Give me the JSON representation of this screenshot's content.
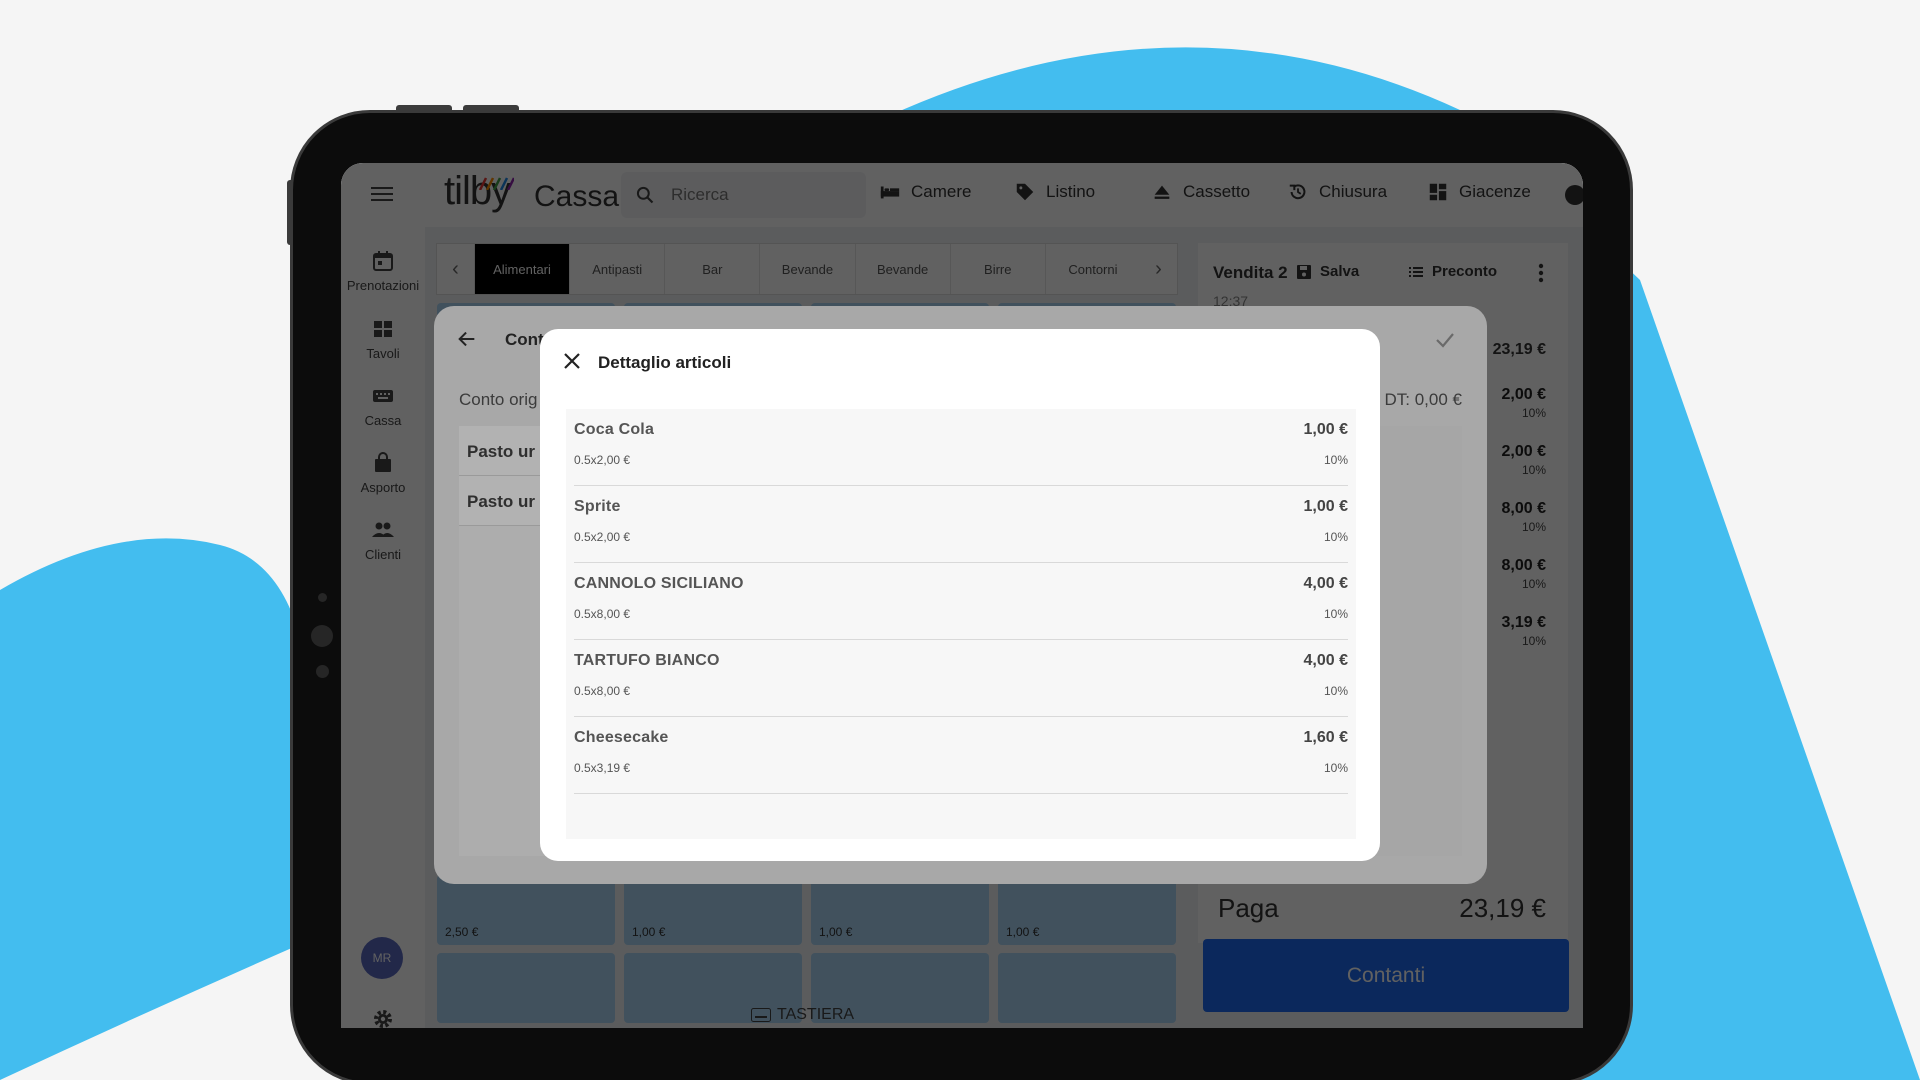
{
  "app": {
    "logo_text": "tilby",
    "title": "Cassa",
    "search_placeholder": "Ricerca"
  },
  "nav": [
    {
      "label": "Camere",
      "icon": "bed-icon"
    },
    {
      "label": "Listino",
      "icon": "price-tag-icon"
    },
    {
      "label": "Cassetto",
      "icon": "eject-icon"
    },
    {
      "label": "Chiusura",
      "icon": "history-icon"
    },
    {
      "label": "Giacenze",
      "icon": "dashboard-icon"
    }
  ],
  "rail": [
    {
      "label": "Prenotazioni",
      "icon": "calendar-icon"
    },
    {
      "label": "Tavoli",
      "icon": "tables-icon"
    },
    {
      "label": "Cassa",
      "icon": "keyboard-icon"
    },
    {
      "label": "Asporto",
      "icon": "bag-icon"
    },
    {
      "label": "Clienti",
      "icon": "people-icon"
    }
  ],
  "user_initials": "MR",
  "categories": [
    "Alimentari",
    "Antipasti",
    "Bar",
    "Bevande",
    "Bevande",
    "Birre",
    "Contorni"
  ],
  "product_prices": [
    "2,50 €",
    "1,00 €",
    "1,00 €",
    "1,00 €"
  ],
  "keyboard_label": "TASTIERA",
  "cart": {
    "title": "Vendita 2",
    "save_label": "Salva",
    "preconto_label": "Preconto",
    "time": "12:37",
    "total_label": "T: 23,19 €",
    "items": [
      {
        "value": "2,00 €",
        "vat": "10%"
      },
      {
        "value": "2,00 €",
        "vat": "10%"
      },
      {
        "value": "8,00 €",
        "vat": "10%"
      },
      {
        "value": "8,00 €",
        "vat": "10%"
      },
      {
        "value": "3,19 €",
        "vat": "10%"
      }
    ],
    "pay_label": "Paga",
    "pay_amount": "23,19 €",
    "cash_label": "Contanti"
  },
  "split_dialog": {
    "title": "Cont",
    "subtitle": "Conto orig",
    "right_total": "DT: 0,00 €",
    "items": [
      "Pasto ur",
      "Pasto ur"
    ]
  },
  "detail_dialog": {
    "title": "Dettaglio articoli",
    "rows": [
      {
        "name": "Coca Cola",
        "detail": "0.5x2,00 €",
        "amount": "1,00 €",
        "vat": "10%"
      },
      {
        "name": "Sprite",
        "detail": "0.5x2,00 €",
        "amount": "1,00 €",
        "vat": "10%"
      },
      {
        "name": "CANNOLO SICILIANO",
        "detail": "0.5x8,00 €",
        "amount": "4,00 €",
        "vat": "10%"
      },
      {
        "name": "TARTUFO BIANCO",
        "detail": "0.5x8,00 €",
        "amount": "4,00 €",
        "vat": "10%"
      },
      {
        "name": "Cheesecake",
        "detail": "0.5x3,19 €",
        "amount": "1,60 €",
        "vat": "10%"
      }
    ]
  },
  "colors": {
    "accent_blue": "#43bdef",
    "primary_button": "#1e6bf0",
    "tile_blue": "#a9d4f5"
  }
}
